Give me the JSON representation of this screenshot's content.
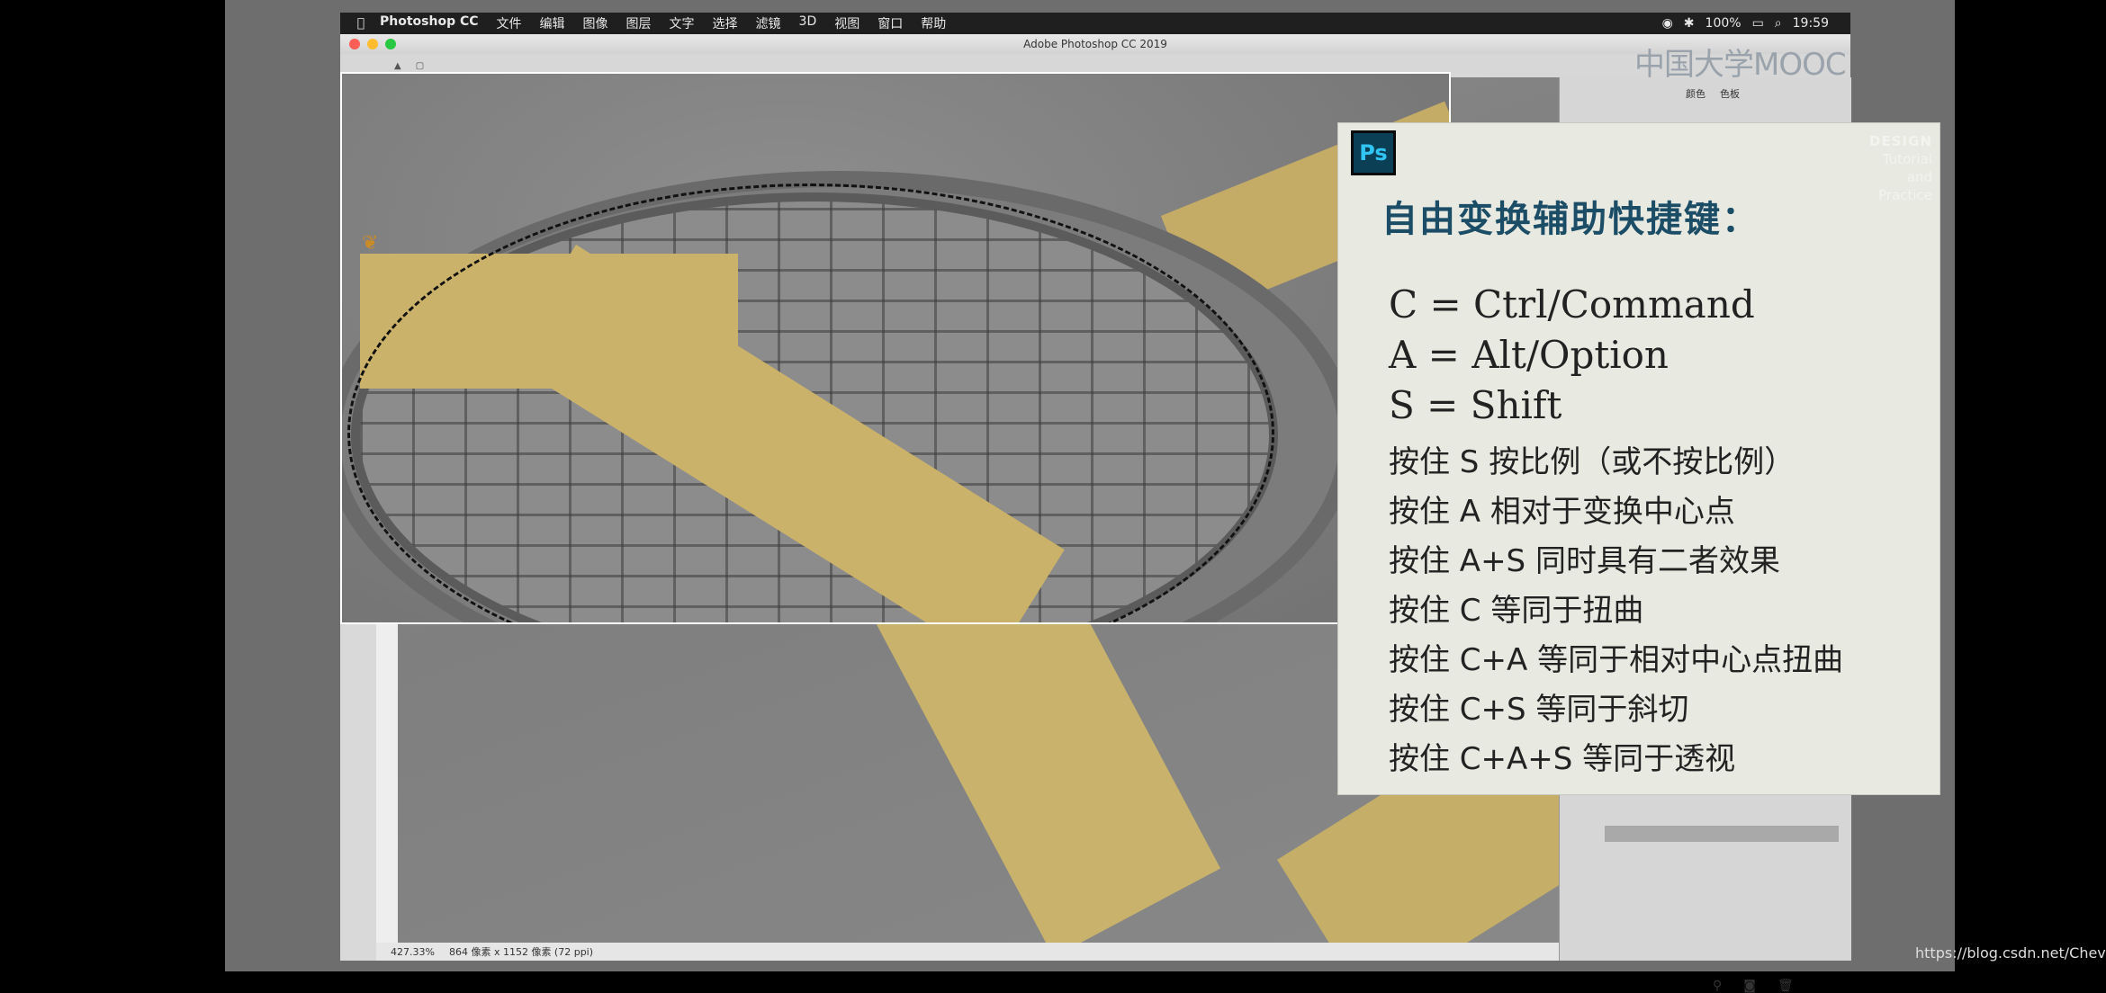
{
  "mac_menu": {
    "apple": "",
    "items": [
      "Photoshop CC",
      "文件",
      "编辑",
      "图像",
      "图层",
      "文字",
      "选择",
      "滤镜",
      "3D",
      "视图",
      "窗口",
      "帮助"
    ],
    "battery": "100%",
    "time": "19:59"
  },
  "window": {
    "title": "Adobe Photoshop CC 2019"
  },
  "statusbar": {
    "zoom": "427.33%",
    "doc_info": "864 像素 x 1152 像素 (72 ppi)"
  },
  "right_panel": {
    "tabs": [
      "颜色",
      "色板"
    ]
  },
  "card": {
    "badge": "Ps",
    "deco_title": "DESIGN",
    "deco_lines": [
      "Tutorial",
      "and",
      "Practice"
    ],
    "title": "自由变换辅助快捷键：",
    "keymap": [
      "C = Ctrl/Command",
      "A = Alt/Option",
      "S = Shift"
    ],
    "rules": [
      "按住 S 按比例（或不按比例）",
      "按住 A 相对于变换中心点",
      "按住 A+S 同时具有二者效果",
      "按住 C 等同于扭曲",
      "按住 C+A 等同于相对中心点扭曲",
      "按住 C+S 等同于斜切",
      "按住 C+A+S 等同于透视"
    ]
  },
  "brand": {
    "mooc": "中国大学MOOC"
  },
  "watermark": "https://blog.csdn.net/Chevily",
  "colors": {
    "foreground": "#e00000",
    "background": "#ffffff",
    "ps_badge_bg": "#0a3f56",
    "ps_badge_text": "#31c5f4",
    "card_title": "#1b4d66"
  }
}
